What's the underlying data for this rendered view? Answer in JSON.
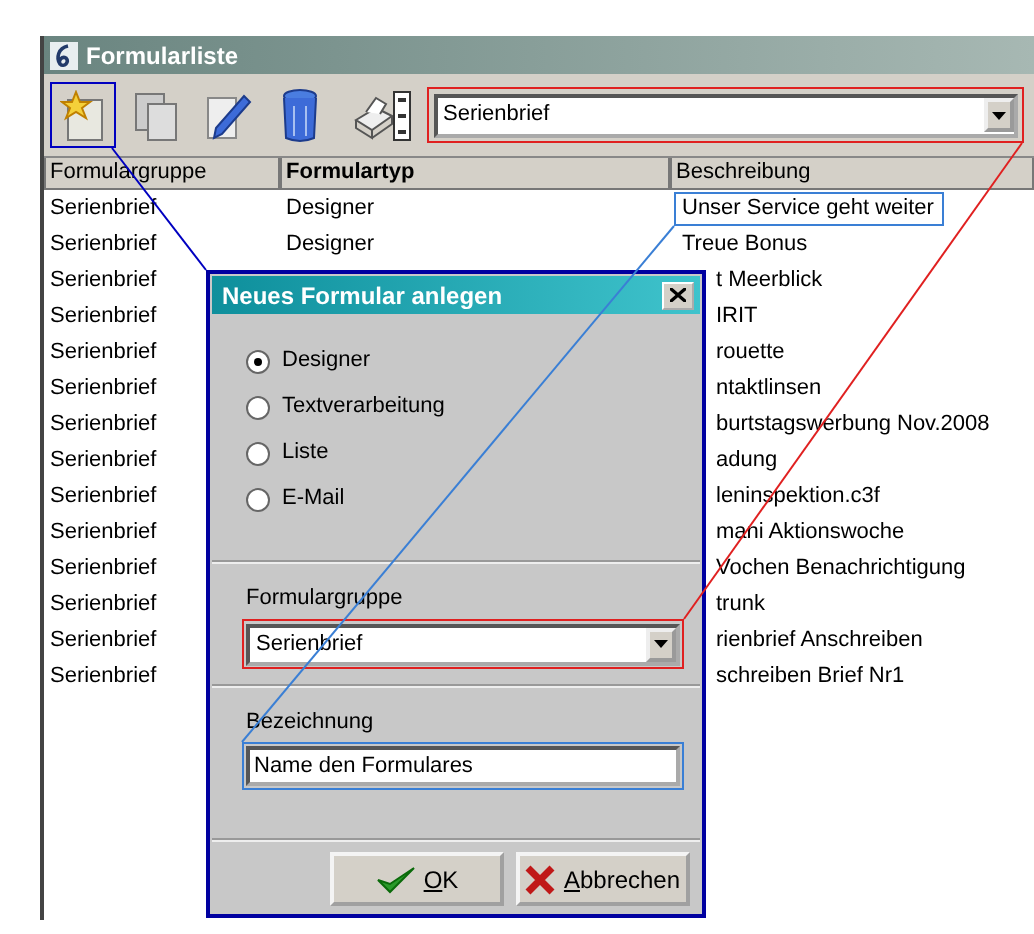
{
  "window": {
    "title": "Formularliste"
  },
  "toolbar": {
    "filter": "Serienbrief"
  },
  "table": {
    "columns": [
      "Formulargruppe",
      "Formulartyp",
      "Beschreibung"
    ],
    "rows": [
      {
        "formulargruppe": "Serienbrief",
        "formulartyp": "Designer",
        "beschreibung": "Unser Service geht weiter",
        "selected": true
      },
      {
        "formulargruppe": "Serienbrief",
        "formulartyp": "Designer",
        "beschreibung": "Treue Bonus",
        "selected": false
      },
      {
        "formulargruppe": "Serienbrief",
        "beschreibung": "t Meerblick",
        "selected": false
      },
      {
        "formulargruppe": "Serienbrief",
        "beschreibung": "IRIT",
        "selected": false
      },
      {
        "formulargruppe": "Serienbrief",
        "beschreibung": "rouette",
        "selected": false
      },
      {
        "formulargruppe": "Serienbrief",
        "beschreibung": "ntaktlinsen",
        "selected": false
      },
      {
        "formulargruppe": "Serienbrief",
        "beschreibung": "burtstagswerbung Nov.2008",
        "selected": false
      },
      {
        "formulargruppe": "Serienbrief",
        "beschreibung": "adung",
        "selected": false
      },
      {
        "formulargruppe": "Serienbrief",
        "beschreibung": "leninspektion.c3f",
        "selected": false
      },
      {
        "formulargruppe": "Serienbrief",
        "beschreibung": "mani Aktionswoche",
        "selected": false
      },
      {
        "formulargruppe": "Serienbrief",
        "beschreibung": "Vochen Benachrichtigung",
        "selected": false
      },
      {
        "formulargruppe": "Serienbrief",
        "beschreibung": "trunk",
        "selected": false
      },
      {
        "formulargruppe": "Serienbrief",
        "beschreibung": "rienbrief Anschreiben",
        "selected": false
      },
      {
        "formulargruppe": "Serienbrief",
        "beschreibung": "schreiben Brief Nr1",
        "selected": false
      }
    ]
  },
  "dialog": {
    "title": "Neues Formular anlegen",
    "types": [
      {
        "label": "Designer",
        "selected": true
      },
      {
        "label": "Textverarbeitung",
        "selected": false
      },
      {
        "label": "Liste",
        "selected": false
      },
      {
        "label": "E-Mail",
        "selected": false
      }
    ],
    "group_label": "Formulargruppe",
    "group_value": "Serienbrief",
    "name_label": "Bezeichnung",
    "name_value": "Name den Formulares",
    "buttons": [
      {
        "label": "OK",
        "kind": "ok"
      },
      {
        "label": "Abbrechen",
        "kind": "cancel"
      }
    ]
  }
}
